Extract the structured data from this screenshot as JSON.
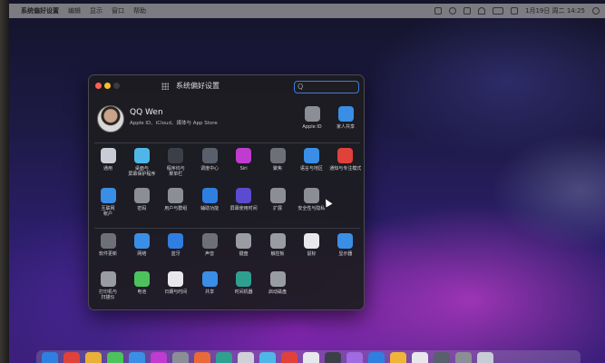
{
  "menubar": {
    "apple_glyph": "",
    "app_name": "系统偏好设置",
    "menus": [
      "编辑",
      "显示",
      "窗口",
      "帮助"
    ],
    "clock": "1月19日 周二 14:25"
  },
  "window": {
    "title": "系统偏好设置",
    "search_placeholder": "Q"
  },
  "account": {
    "name": "QQ Wen",
    "subtitle": "Apple ID、iCloud、媒体与 App Store",
    "apple_id_label": "Apple ID",
    "family_label": "家人共享"
  },
  "rows": [
    [
      {
        "label": "通用",
        "icon": "general-icon",
        "color": "#c8ccd4"
      },
      {
        "label": "桌面与\n屏幕保护程序",
        "icon": "desktop-icon",
        "color": "#4fb7e8"
      },
      {
        "label": "程序坞与\n菜单栏",
        "icon": "dock-icon",
        "color": "#3b3f48"
      },
      {
        "label": "调度中心",
        "icon": "mission-control-icon",
        "color": "#59606c"
      },
      {
        "label": "Siri",
        "icon": "siri-icon",
        "color": "#c03bd0"
      },
      {
        "label": "聚焦",
        "icon": "spotlight-icon",
        "color": "#6e7078"
      },
      {
        "label": "语言与地区",
        "icon": "language-icon",
        "color": "#3a8ee6"
      },
      {
        "label": "通知与专注模式",
        "icon": "notifications-icon",
        "color": "#e0413a"
      }
    ],
    [
      {
        "label": "互联网\n帐户",
        "icon": "internet-accounts-icon",
        "color": "#3a8ee6"
      },
      {
        "label": "密码",
        "icon": "passwords-icon",
        "color": "#8c8e96"
      },
      {
        "label": "用户与群组",
        "icon": "users-icon",
        "color": "#8c8e96"
      },
      {
        "label": "辅助功能",
        "icon": "accessibility-icon",
        "color": "#2f7fe0"
      },
      {
        "label": "屏幕使用时间",
        "icon": "screen-time-icon",
        "color": "#5a4bd0"
      },
      {
        "label": "扩展",
        "icon": "extensions-icon",
        "color": "#8c8e96"
      },
      {
        "label": "安全性与隐私",
        "icon": "security-icon",
        "color": "#8c8e96"
      }
    ],
    [
      {
        "label": "软件更新",
        "icon": "software-update-icon",
        "color": "#6e7078"
      },
      {
        "label": "网络",
        "icon": "network-icon",
        "color": "#3a8ee6"
      },
      {
        "label": "蓝牙",
        "icon": "bluetooth-icon",
        "color": "#2f7fe0"
      },
      {
        "label": "声音",
        "icon": "sound-icon",
        "color": "#6e7078"
      },
      {
        "label": "键盘",
        "icon": "keyboard-icon",
        "color": "#9a9ca4"
      },
      {
        "label": "触控板",
        "icon": "trackpad-icon",
        "color": "#9a9ca4"
      },
      {
        "label": "鼠标",
        "icon": "mouse-icon",
        "color": "#e8e8ec"
      },
      {
        "label": "显示器",
        "icon": "displays-icon",
        "color": "#3a8ee6"
      }
    ],
    [
      {
        "label": "打印机与\n扫描仪",
        "icon": "printers-icon",
        "color": "#9a9ca4"
      },
      {
        "label": "电池",
        "icon": "battery-icon",
        "color": "#4cc25c"
      },
      {
        "label": "日期与时间",
        "icon": "date-time-icon",
        "color": "#e8e8ec"
      },
      {
        "label": "共享",
        "icon": "sharing-icon",
        "color": "#3a8ee6"
      },
      {
        "label": "时间机器",
        "icon": "time-machine-icon",
        "color": "#2f9f8f"
      },
      {
        "label": "启动磁盘",
        "icon": "startup-disk-icon",
        "color": "#9a9ca4"
      }
    ]
  ]
}
